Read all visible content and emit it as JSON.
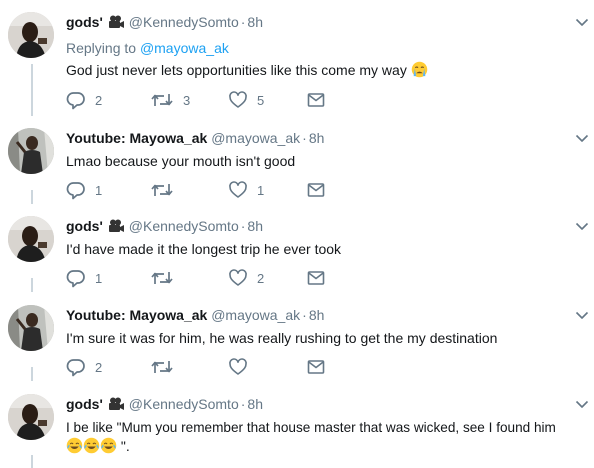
{
  "tweets": [
    {
      "name": "gods'",
      "has_camera_emoji": true,
      "handle": "@KennedySomto",
      "time": "8h",
      "replying_prefix": "Replying to",
      "replying_to": "@mayowa_ak",
      "text": "God just never lets opportunities like this come my way",
      "trailing_emoji": "crying-face",
      "reply_count": "2",
      "retweet_count": "3",
      "like_count": "5"
    },
    {
      "name": "Youtube: Mayowa_ak",
      "handle": "@mayowa_ak",
      "time": "8h",
      "text": "Lmao because your mouth isn't good",
      "reply_count": "1",
      "retweet_count": "",
      "like_count": "1"
    },
    {
      "name": "gods'",
      "has_camera_emoji": true,
      "handle": "@KennedySomto",
      "time": "8h",
      "text": "I'd have made it the longest trip he ever took",
      "reply_count": "1",
      "retweet_count": "",
      "like_count": "2"
    },
    {
      "name": "Youtube: Mayowa_ak",
      "handle": "@mayowa_ak",
      "time": "8h",
      "text": "I'm sure it was for him, he was really rushing to get the my destination",
      "reply_count": "2",
      "retweet_count": "",
      "like_count": ""
    },
    {
      "name": "gods'",
      "has_camera_emoji": true,
      "handle": "@KennedySomto",
      "time": "8h",
      "text_line1": "I be like \"Mum you remember that house master that was wicked, see I found him",
      "text_line2_suffix": " \".",
      "trailing_emojis": [
        "tears-of-joy",
        "tears-of-joy",
        "tears-of-joy"
      ]
    }
  ],
  "separator": "·",
  "colors": {
    "text": "#14171a",
    "secondary": "#657786",
    "link": "#1da1f2",
    "thread_line": "#ccd6dd"
  },
  "icons": [
    "reply-icon",
    "retweet-icon",
    "like-icon",
    "direct-message-icon",
    "chevron-down-icon",
    "movie-camera-emoji"
  ]
}
